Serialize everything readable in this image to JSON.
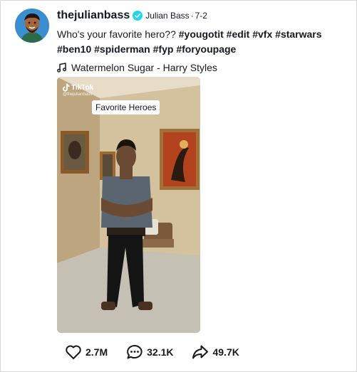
{
  "post": {
    "username": "thejulianbass",
    "display_name": "Julian Bass",
    "separator": "·",
    "date": "7-2",
    "caption_text": "Who's your favorite hero??",
    "hashtags": [
      "#yougotit",
      "#edit",
      "#vfx",
      "#starwars",
      "#ben10",
      "#spiderman",
      "#fyp",
      "#foryoupage"
    ],
    "music": "Watermelon Sugar - Harry Styles"
  },
  "video": {
    "watermark_brand": "TikTok",
    "watermark_handle": "@thejulianbass",
    "overlay_text": "Favorite Heroes"
  },
  "stats": {
    "likes": "2.7M",
    "comments": "32.1K",
    "shares": "49.7K"
  },
  "colors": {
    "verified": "#20d5ec",
    "text": "#161823"
  },
  "icons": {
    "like": "heart-icon",
    "comment": "comment-bubble-icon",
    "share": "share-arrow-icon",
    "music": "music-note-icon",
    "verified": "verified-badge-icon"
  }
}
